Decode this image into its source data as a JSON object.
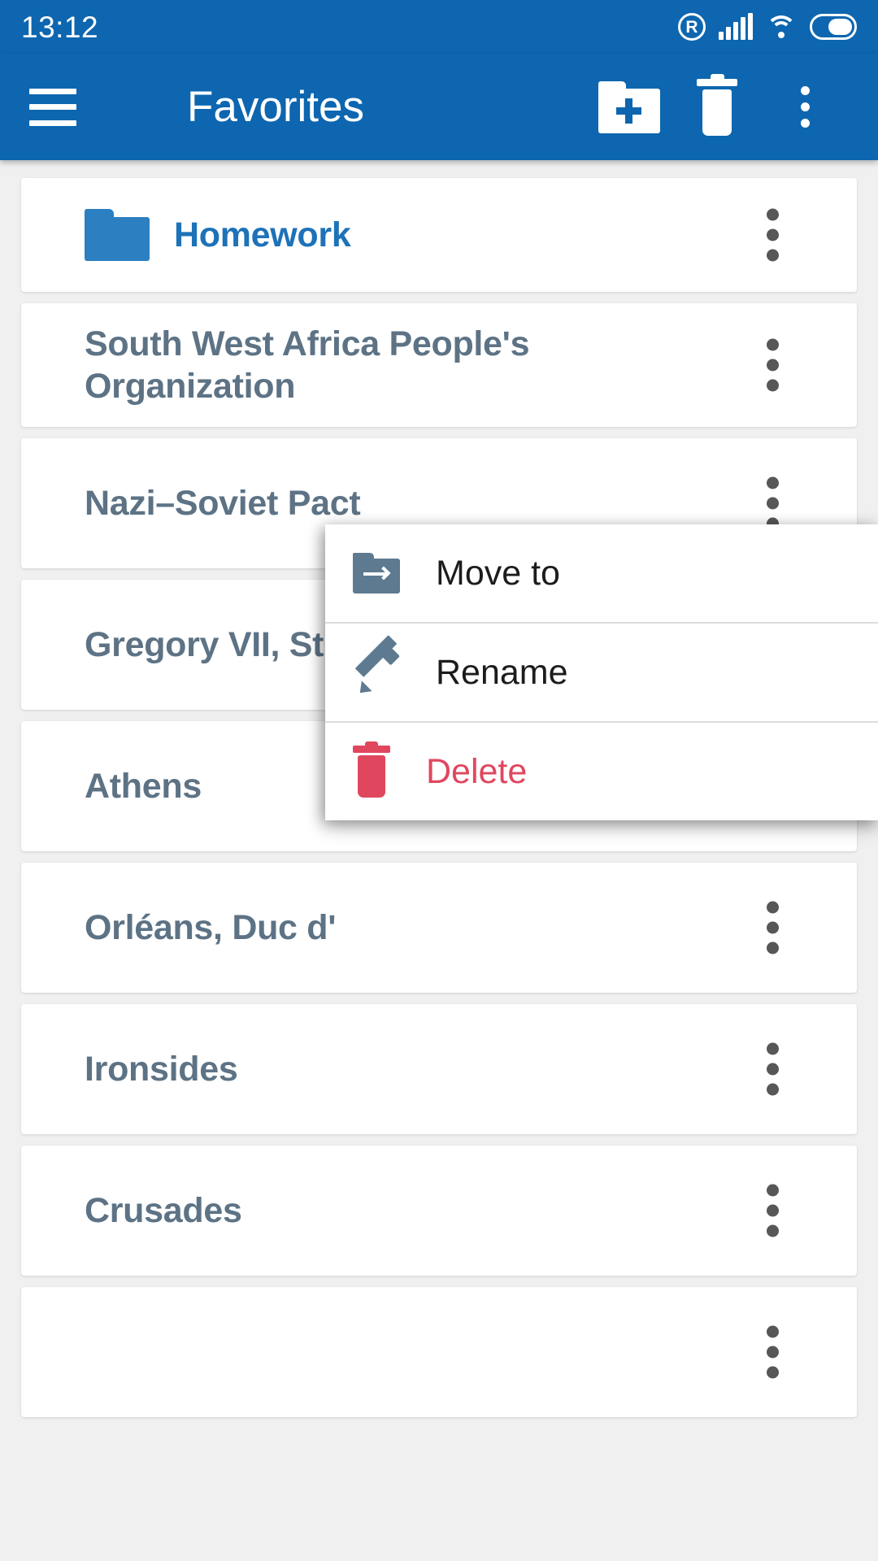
{
  "status_bar": {
    "time": "13:12",
    "icons": {
      "roaming": "R",
      "signal": "signal-icon",
      "wifi": "wifi-icon",
      "battery": "battery-icon"
    }
  },
  "app_bar": {
    "menu_icon": "hamburger-menu-icon",
    "title": "Favorites",
    "new_folder_icon": "new-folder-icon",
    "delete_icon": "trash-icon",
    "overflow_icon": "kebab-menu-icon"
  },
  "colors": {
    "primary": "#0D66AF",
    "background": "#F0F0F0",
    "card": "#FFFFFF",
    "item_text": "#5D7385",
    "folder_text": "#1D72B8",
    "folder_icon": "#2C7FC0",
    "danger": "#E0475F",
    "menu_icon": "#5E7A90",
    "kebab": "#575757"
  },
  "list": {
    "items": [
      {
        "label": "Homework",
        "type": "folder",
        "icon": "folder-icon",
        "overflow_icon": "kebab-menu-icon"
      },
      {
        "label": "South West Africa People's Organization",
        "type": "entry",
        "overflow_icon": "kebab-menu-icon"
      },
      {
        "label": "Nazi–Soviet Pact",
        "type": "entry",
        "overflow_icon": "kebab-menu-icon"
      },
      {
        "label": "Gregory VII, St",
        "type": "entry",
        "overflow_icon": "kebab-menu-icon"
      },
      {
        "label": "Athens",
        "type": "entry",
        "overflow_icon": "kebab-menu-icon"
      },
      {
        "label": "Orléans, Duc d'",
        "type": "entry",
        "overflow_icon": "kebab-menu-icon"
      },
      {
        "label": "Ironsides",
        "type": "entry",
        "overflow_icon": "kebab-menu-icon"
      },
      {
        "label": "Crusades",
        "type": "entry",
        "overflow_icon": "kebab-menu-icon"
      },
      {
        "label": "",
        "type": "entry",
        "overflow_icon": "kebab-menu-icon"
      }
    ]
  },
  "context_menu": {
    "visible": true,
    "items": [
      {
        "label": "Move to",
        "icon": "move-to-folder-icon",
        "danger": false
      },
      {
        "label": "Rename",
        "icon": "pencil-icon",
        "danger": false
      },
      {
        "label": "Delete",
        "icon": "trash-icon",
        "danger": true
      }
    ]
  }
}
